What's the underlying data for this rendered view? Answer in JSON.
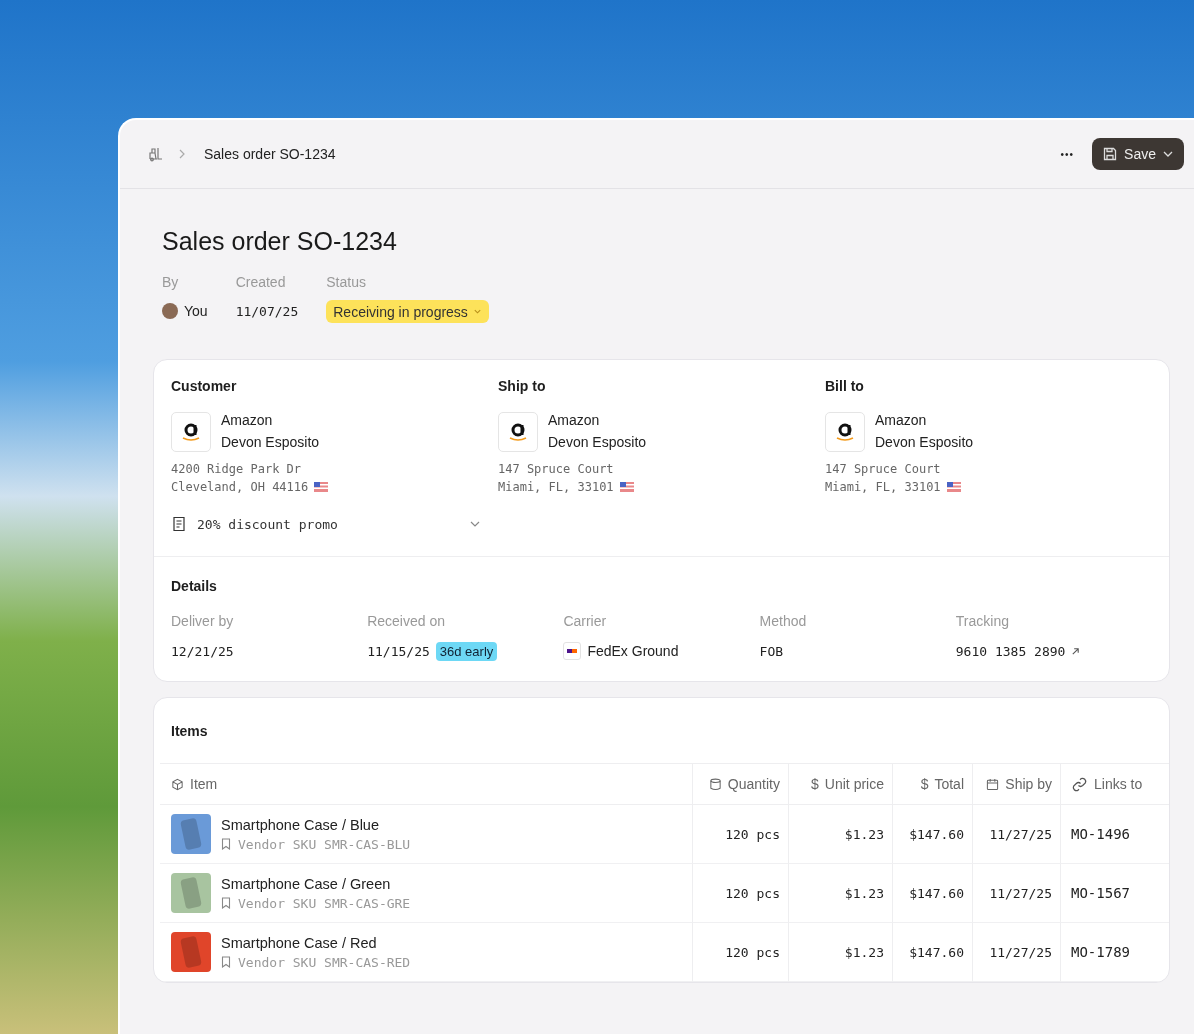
{
  "breadcrumb": {
    "current": "Sales order SO-1234"
  },
  "toolbar": {
    "more": "•••",
    "save": "Save"
  },
  "title": "Sales order SO-1234",
  "meta": [
    {
      "label": "By",
      "value": "You",
      "kind": "avatar"
    },
    {
      "label": "Created",
      "value": "11/07/25",
      "kind": "text"
    },
    {
      "label": "Status",
      "value": "Receiving in progress",
      "kind": "status"
    }
  ],
  "parties": [
    {
      "heading": "Customer",
      "company": "Amazon",
      "contact": "Devon Esposito",
      "address": [
        "4200 Ridge Park Dr",
        "Cleveland, OH 44116"
      ]
    },
    {
      "heading": "Ship to",
      "company": "Amazon",
      "contact": "Devon Esposito",
      "address": [
        "147 Spruce Court",
        "Miami, FL, 33101"
      ]
    },
    {
      "heading": "Bill to",
      "company": "Amazon",
      "contact": "Devon Esposito",
      "address": [
        "147 Spruce Court",
        "Miami, FL, 33101"
      ]
    }
  ],
  "promo": {
    "label": "20% discount promo",
    "expanded": false
  },
  "details": {
    "heading": "Details",
    "fields": [
      {
        "label": "Deliver by",
        "value": "12/21/25",
        "kind": "text"
      },
      {
        "label": "Received on",
        "value": "11/15/25",
        "badge": "36d early",
        "kind": "badge"
      },
      {
        "label": "Carrier",
        "value": "FedEx Ground",
        "kind": "carrier"
      },
      {
        "label": "Method",
        "value": "FOB",
        "kind": "text"
      },
      {
        "label": "Tracking",
        "value": "9610 1385 2890",
        "kind": "link"
      }
    ]
  },
  "items": {
    "heading": "Items",
    "columns": [
      {
        "label": "Item",
        "kind": "cube"
      },
      {
        "label": "Quantity",
        "kind": "cylinder"
      },
      {
        "label": "Unit price",
        "kind": "symbol",
        "symbol": "$"
      },
      {
        "label": "Total",
        "kind": "symbol",
        "symbol": "$"
      },
      {
        "label": "Ship by",
        "kind": "calendar"
      },
      {
        "label": "Links to",
        "kind": "link"
      }
    ],
    "rows": [
      {
        "name": "Smartphone Case / Blue",
        "sku": "Vendor SKU SMR-CAS-BLU",
        "color": "#6a9ad8",
        "quantity": "120 pcs",
        "unit_price": "$1.23",
        "total": "$147.60",
        "ship_by": "11/27/25",
        "links_to": "MO-1496"
      },
      {
        "name": "Smartphone Case / Green",
        "sku": "Vendor SKU SMR-CAS-GRE",
        "color": "#a8c4a0",
        "quantity": "120 pcs",
        "unit_price": "$1.23",
        "total": "$147.60",
        "ship_by": "11/27/25",
        "links_to": "MO-1567"
      },
      {
        "name": "Smartphone Case / Red",
        "sku": "Vendor SKU SMR-CAS-RED",
        "color": "#e0452a",
        "quantity": "120 pcs",
        "unit_price": "$1.23",
        "total": "$147.60",
        "ship_by": "11/27/25",
        "links_to": "MO-1789"
      }
    ]
  }
}
